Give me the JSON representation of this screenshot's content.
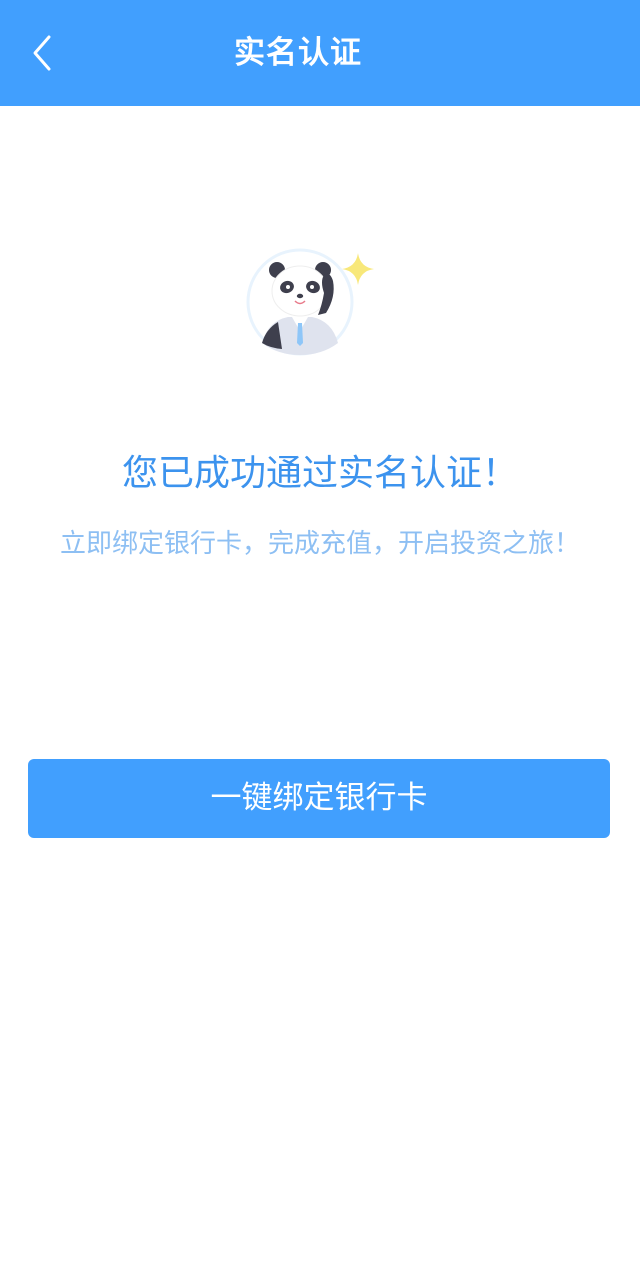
{
  "header": {
    "title": "实名认证",
    "back_icon": "chevron-left-icon"
  },
  "mascot": {
    "icon": "panda-mascot-icon",
    "sparkle_icon": "sparkle-icon"
  },
  "main": {
    "success_title": "您已成功通过实名认证！",
    "success_subtitle": "立即绑定银行卡，完成充值，开启投资之旅！"
  },
  "actions": {
    "bind_card_label": "一键绑定银行卡"
  },
  "colors": {
    "accent": "#419ffe",
    "title_text": "#3c93ee",
    "subtitle_text": "#8dbff3",
    "sparkle": "#f8e87a"
  }
}
